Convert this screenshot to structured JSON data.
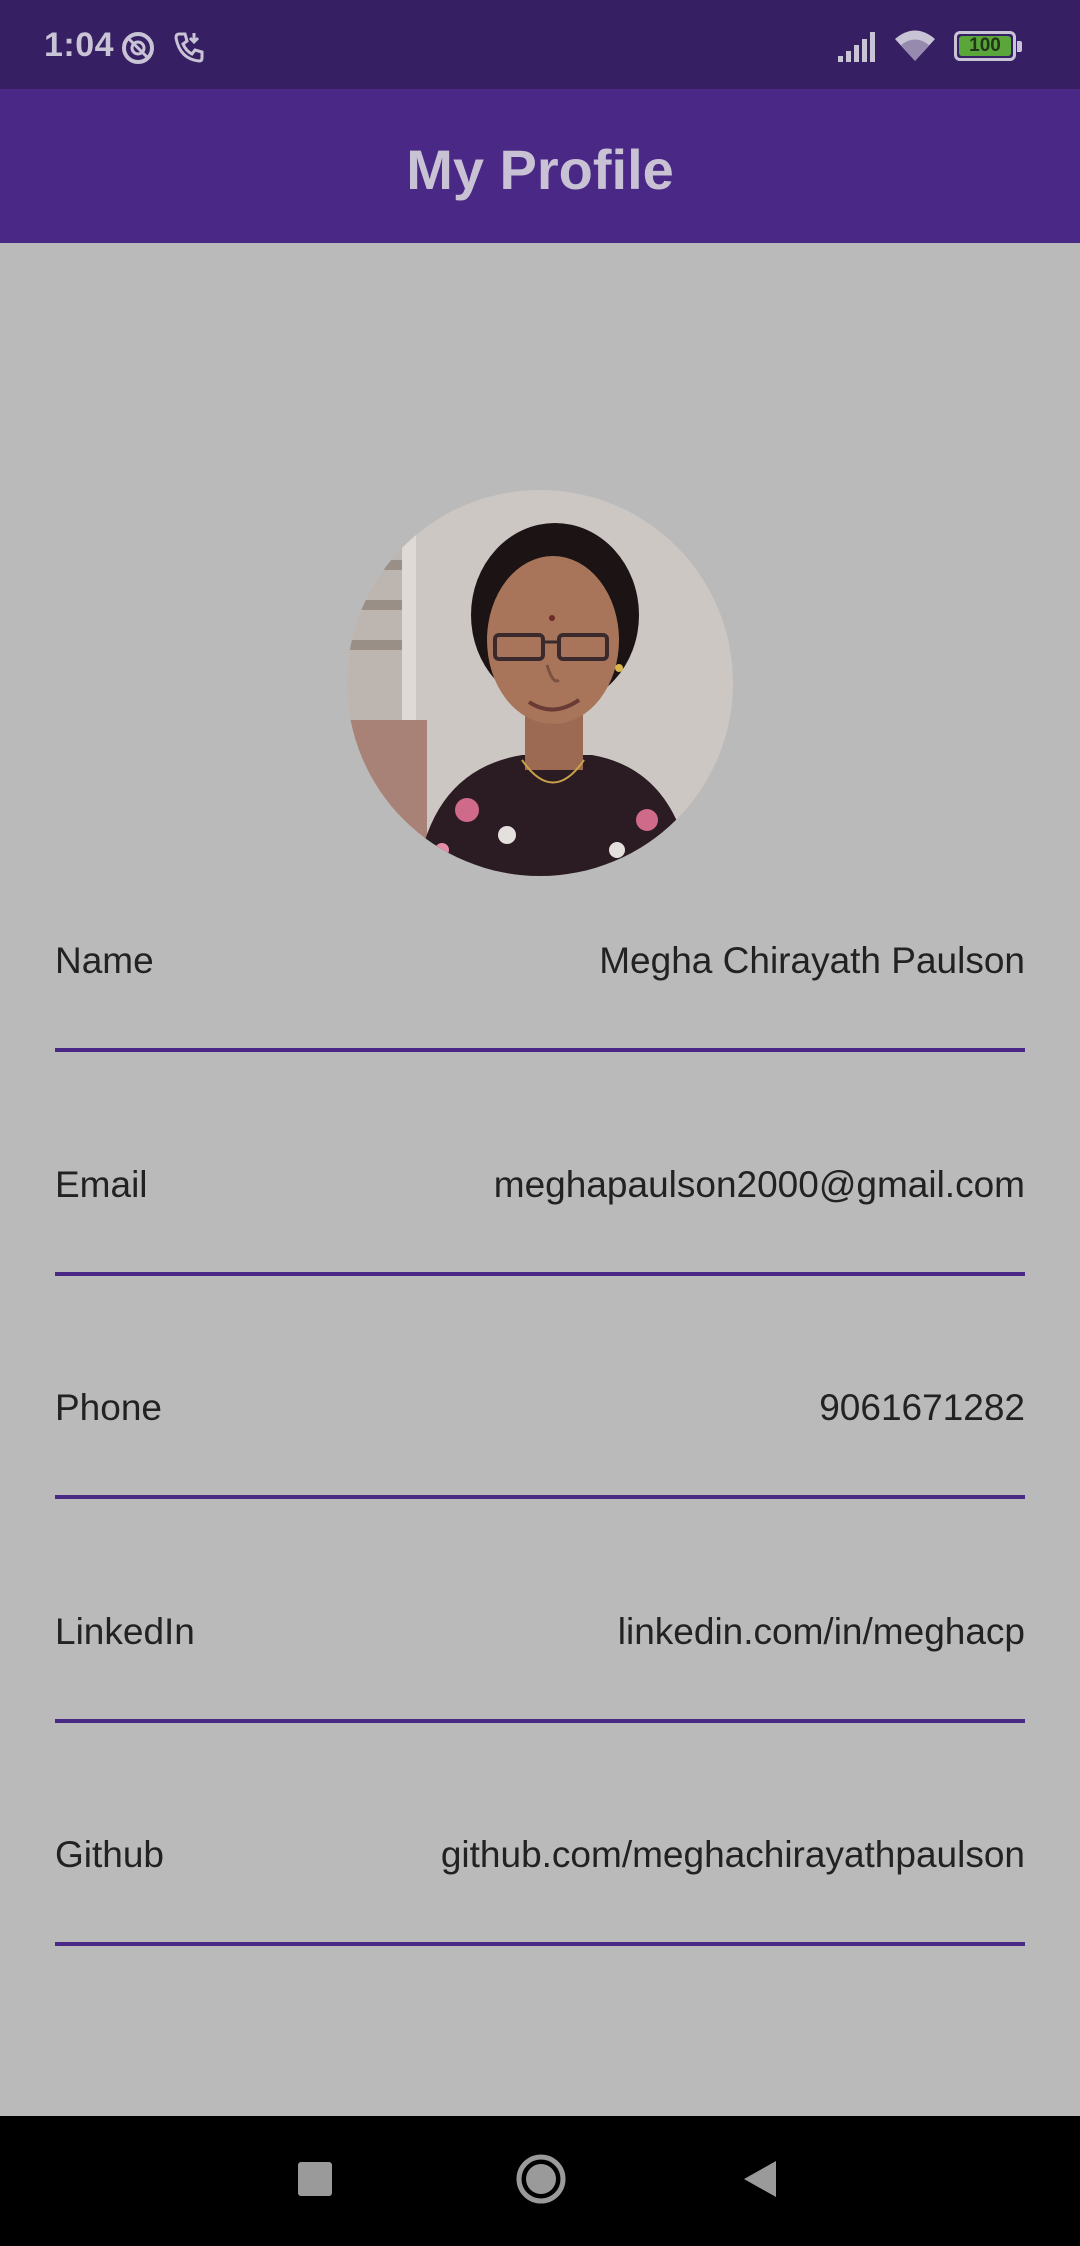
{
  "status_bar": {
    "time": "1:04",
    "battery": "100",
    "icons": [
      "do-not-disturb-icon",
      "call-icon",
      "signal-icon",
      "wifi-icon",
      "battery-icon"
    ]
  },
  "app_bar": {
    "title": "My Profile"
  },
  "profile": {
    "avatar": "profile-photo",
    "fields": [
      {
        "label": "Name",
        "value": "Megha Chirayath Paulson"
      },
      {
        "label": "Email",
        "value": "meghapaulson2000@gmail.com"
      },
      {
        "label": "Phone",
        "value": "9061671282"
      },
      {
        "label": "LinkedIn",
        "value": "linkedin.com/in/meghacp"
      },
      {
        "label": "Github",
        "value": "github.com/meghachirayathpaulson"
      }
    ]
  },
  "nav_bar": {
    "buttons": [
      "recents-button",
      "home-button",
      "back-button"
    ]
  },
  "colors": {
    "status_bar": "#371f63",
    "app_bar": "#4a2886",
    "background": "#bababa",
    "divider": "#4a2886"
  }
}
